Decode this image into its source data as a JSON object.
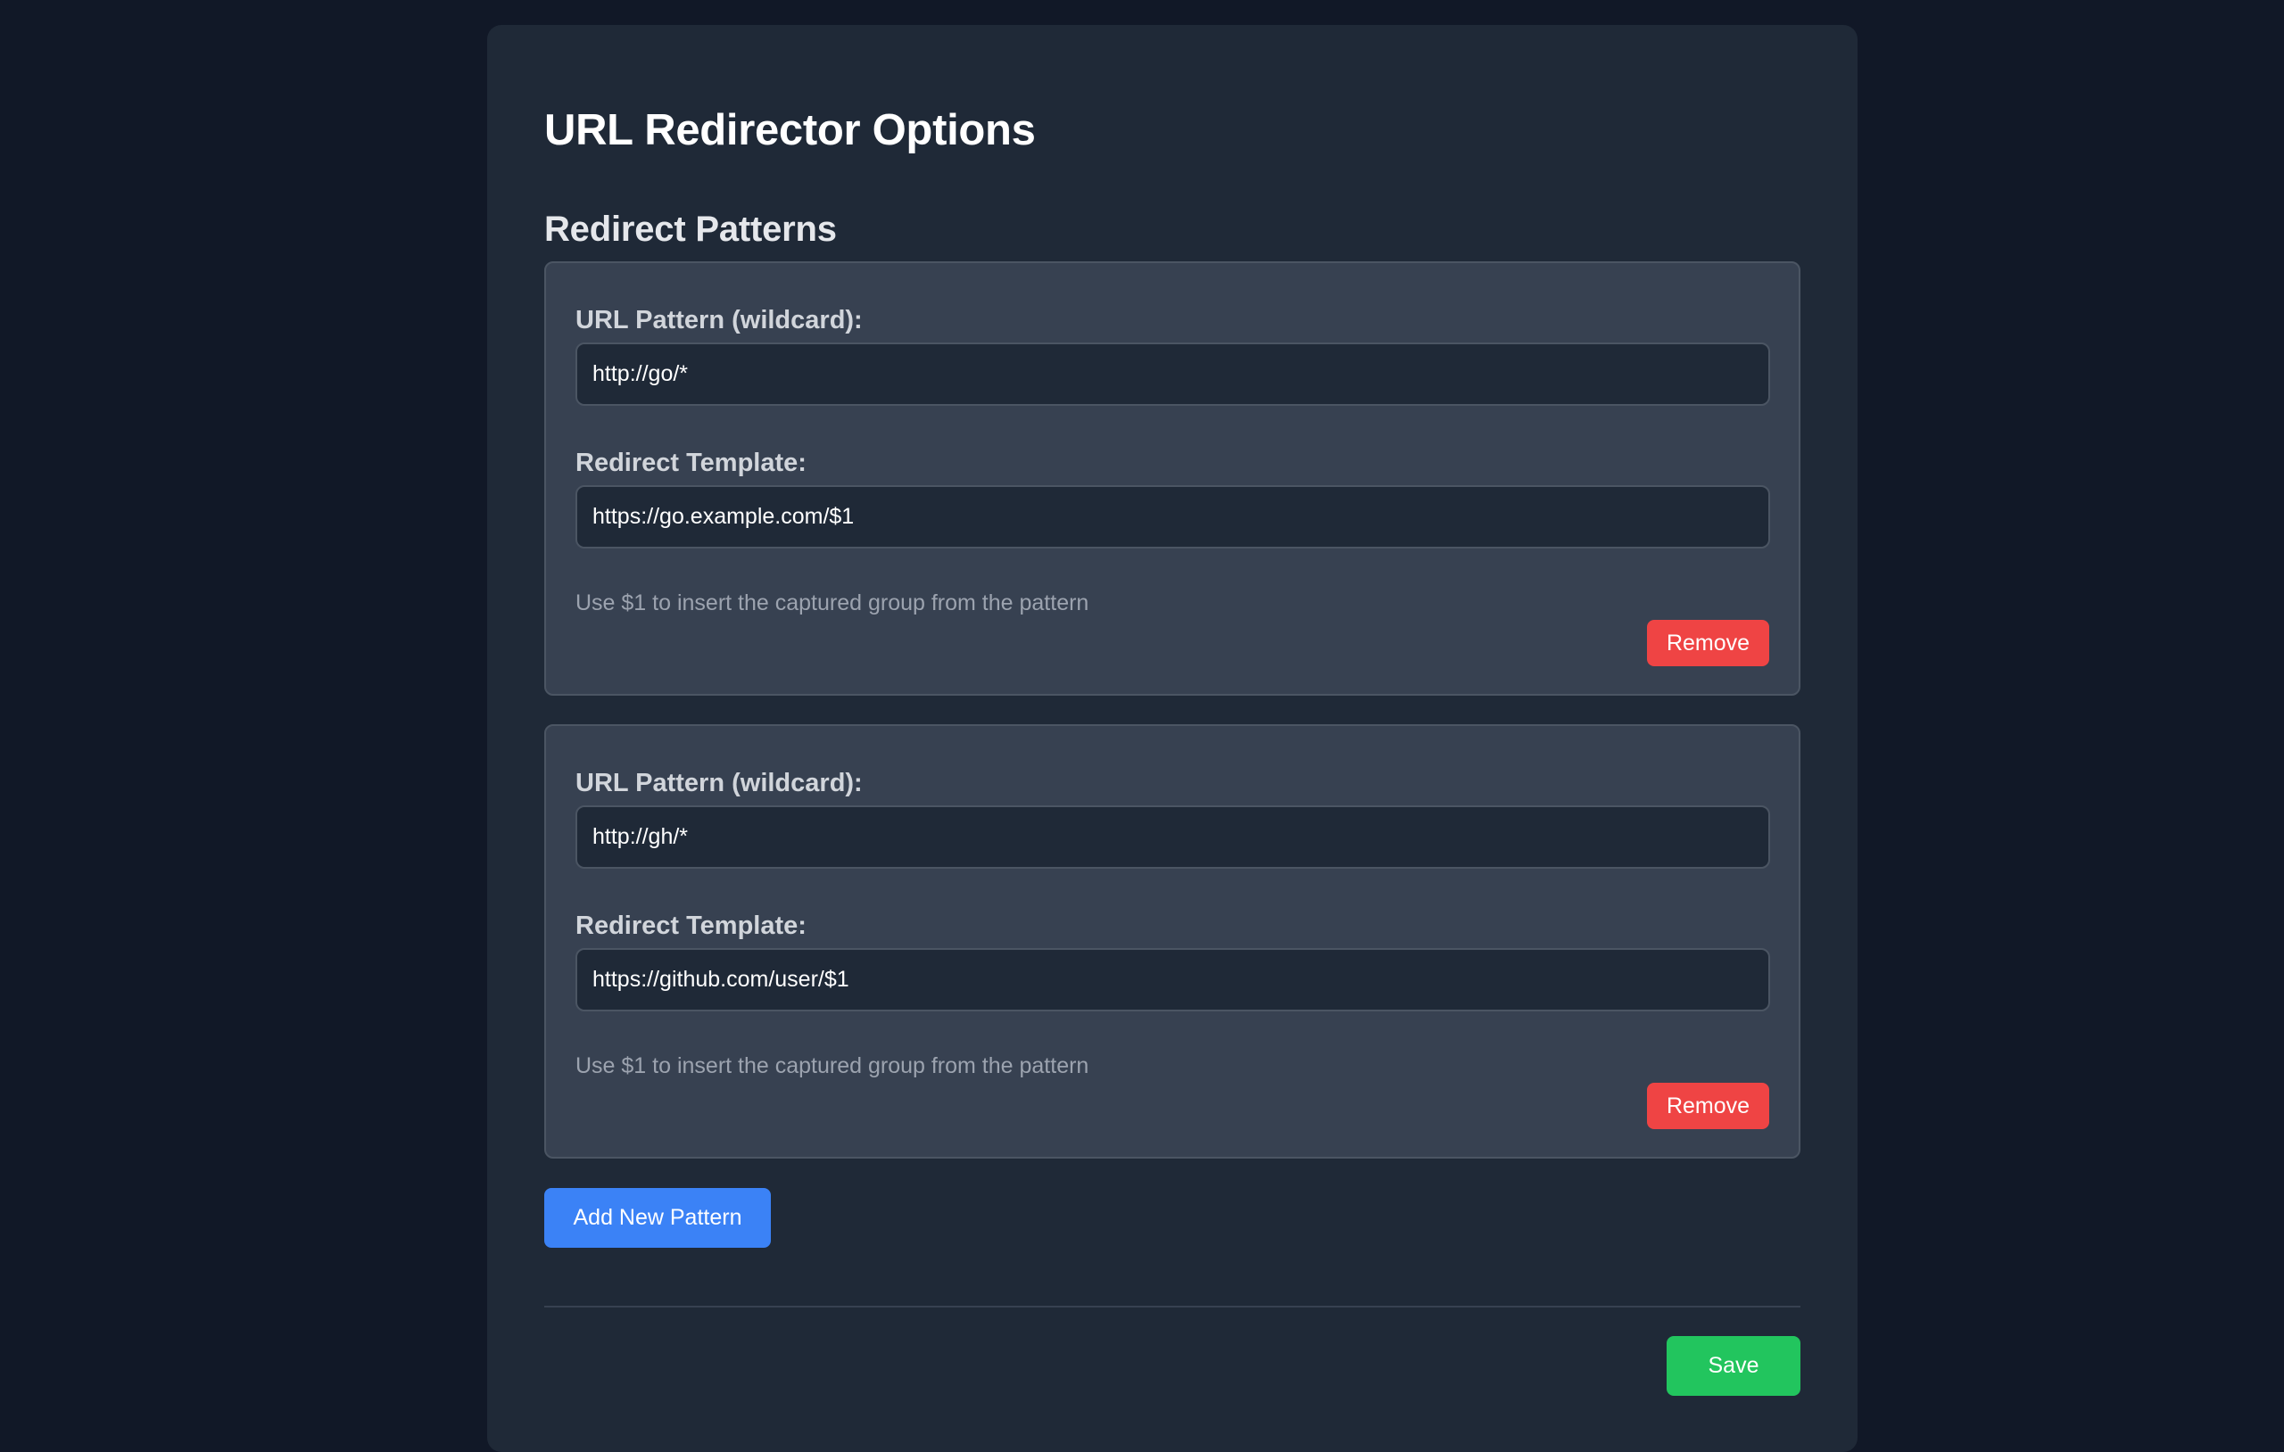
{
  "page": {
    "title": "URL Redirector Options",
    "section_title": "Redirect Patterns"
  },
  "patterns": [
    {
      "pattern_label": "URL Pattern (wildcard):",
      "pattern_value": "http://go/*",
      "template_label": "Redirect Template:",
      "template_value": "https://go.example.com/$1",
      "hint": "Use $1 to insert the captured group from the pattern",
      "remove_label": "Remove"
    },
    {
      "pattern_label": "URL Pattern (wildcard):",
      "pattern_value": "http://gh/*",
      "template_label": "Redirect Template:",
      "template_value": "https://github.com/user/$1",
      "hint": "Use $1 to insert the captured group from the pattern",
      "remove_label": "Remove"
    }
  ],
  "actions": {
    "add_label": "Add New Pattern",
    "save_label": "Save"
  },
  "colors": {
    "background": "#111827",
    "panel": "#1f2937",
    "card": "#374151",
    "remove": "#ef4444",
    "add": "#3b82f6",
    "save": "#22c55e"
  }
}
